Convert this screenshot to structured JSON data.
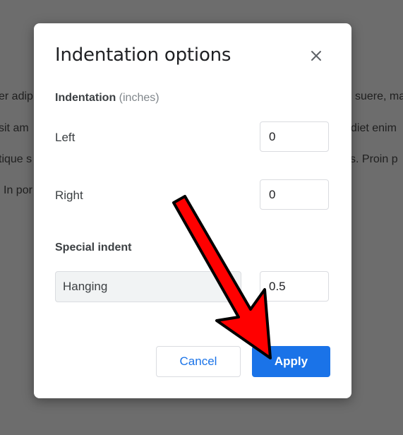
{
  "background_text": {
    "line1_left": "er adip",
    "line1_right": "suere, ma",
    "line2_left": "sit am",
    "line2_right": "diet enim",
    "line3_left": "tique s",
    "line3_right": "s. Proin p",
    "line4_left": "In por"
  },
  "dialog": {
    "title": "Indentation options",
    "indentation_label": "Indentation",
    "indentation_unit": "(inches)",
    "left_label": "Left",
    "left_value": "0",
    "right_label": "Right",
    "right_value": "0",
    "special_label": "Special indent",
    "special_selected": "Hanging",
    "special_value": "0.5",
    "cancel_label": "Cancel",
    "apply_label": "Apply"
  },
  "colors": {
    "overlay": "#6d6d6d",
    "accent": "#1a73e8",
    "arrow": "#ff0000"
  },
  "icons": {
    "close": "close-icon",
    "annotation": "red-arrow-icon"
  }
}
